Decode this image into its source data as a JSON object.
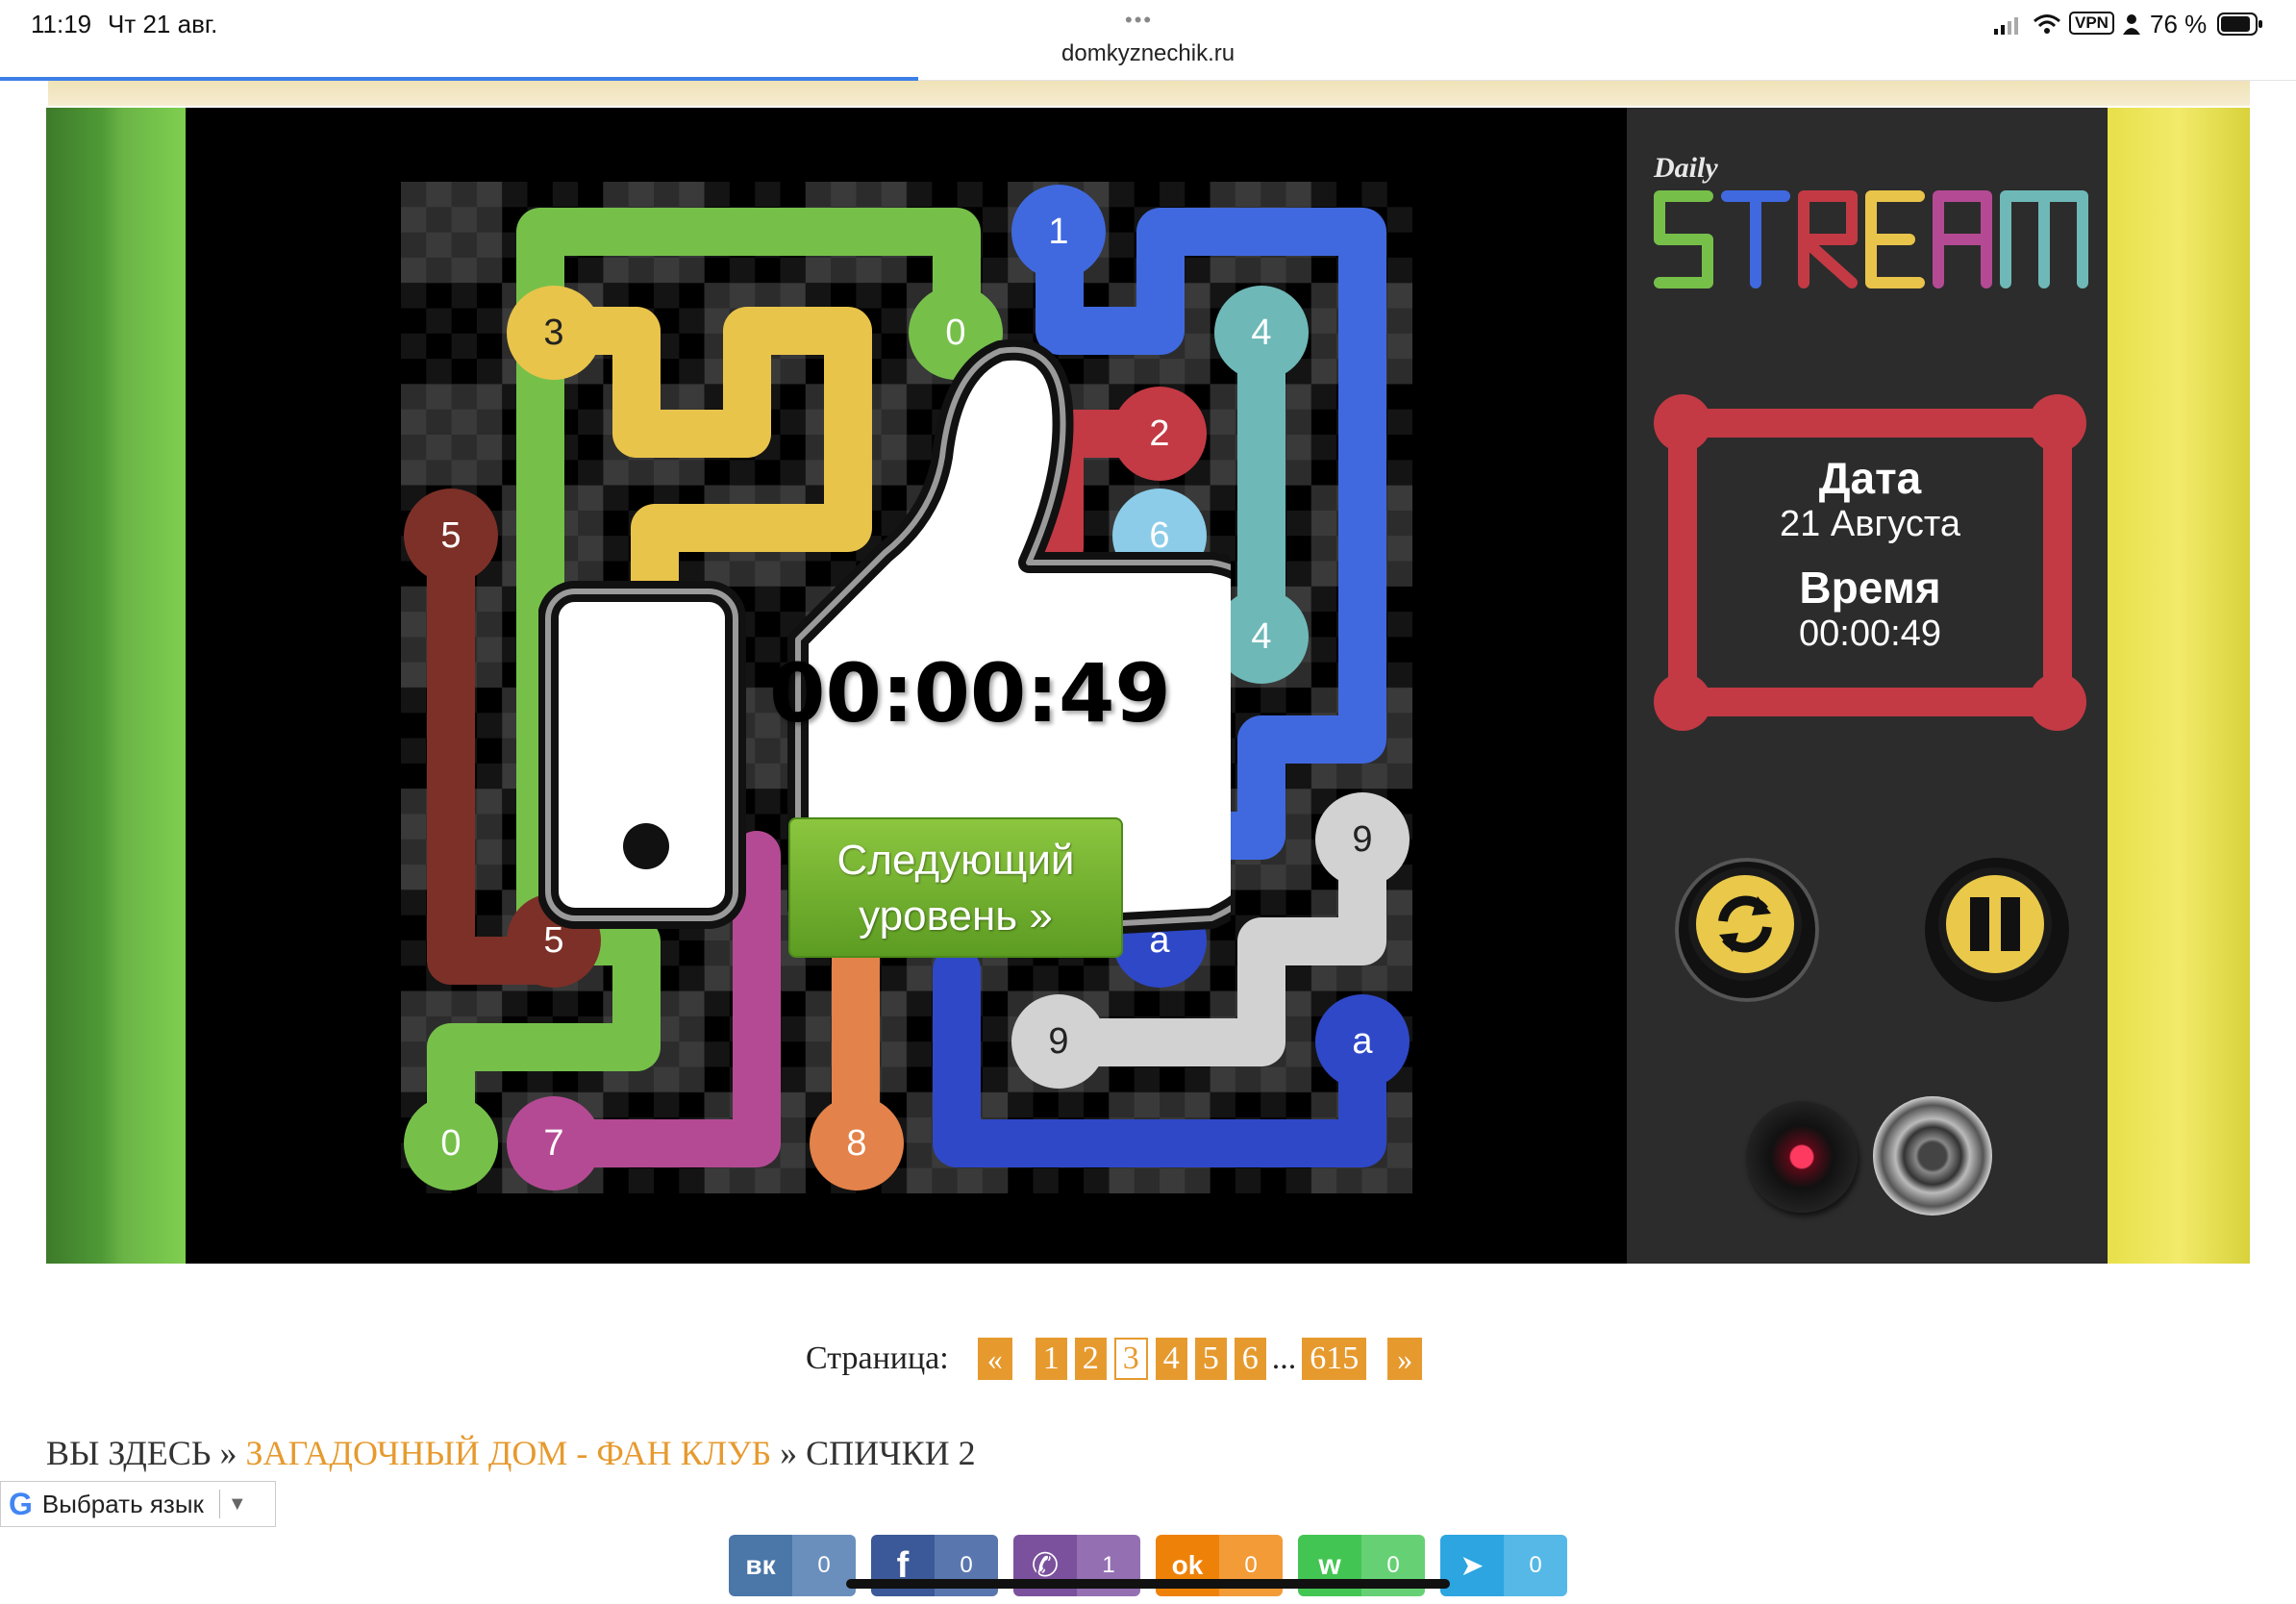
{
  "status_bar": {
    "time": "11:19",
    "date": "Чт 21 авг.",
    "vpn": "VPN",
    "battery": "76 %",
    "url": "domkyznechik.ru",
    "menu_dots": "•••"
  },
  "game": {
    "logo_small": "Daily",
    "logo_big": "STREAM",
    "info": {
      "date_label": "Дата",
      "date_value": "21 Августа",
      "time_label": "Время",
      "time_value": "00:00:49"
    },
    "overlay": {
      "time": "00:00:49",
      "next_button": "Следующий уровень »"
    },
    "dots": [
      {
        "label": "1"
      },
      {
        "label": "0"
      },
      {
        "label": "3"
      },
      {
        "label": "4"
      },
      {
        "label": "2"
      },
      {
        "label": "5"
      },
      {
        "label": "6"
      },
      {
        "label": "4"
      },
      {
        "label": "5"
      },
      {
        "label": "9"
      },
      {
        "label": "a"
      },
      {
        "label": "9"
      },
      {
        "label": "a"
      },
      {
        "label": "0"
      },
      {
        "label": "7"
      },
      {
        "label": "8"
      }
    ],
    "colors": {
      "green": "#76c04a",
      "yellow": "#e9c44a",
      "blue": "#4069e0",
      "teal": "#6fb8b8",
      "red": "#c33a44",
      "brown": "#7c3028",
      "pink": "#b54a94",
      "orange": "#e3824a",
      "gray": "#d2d2d2",
      "navy": "#2f48c8",
      "lightblue": "#8ccce8"
    }
  },
  "pagination": {
    "label": "Страница:",
    "prev": "«",
    "pages": [
      "1",
      "2",
      "3",
      "4",
      "5",
      "6"
    ],
    "current": "3",
    "ellipsis": "...",
    "last": "615",
    "next": "»"
  },
  "breadcrumb": {
    "here": "ВЫ ЗДЕСЬ",
    "sep1": "»",
    "link": "ЗАГАДОЧНЫЙ ДОМ - ФАН КЛУБ",
    "sep2": "»",
    "current": "СПИЧКИ 2"
  },
  "translate": {
    "label": "Выбрать язык",
    "arrow": "▼"
  },
  "share": [
    {
      "icon": "vk-icon",
      "short": "вк",
      "count": "0",
      "color": "#4a76a8"
    },
    {
      "icon": "facebook-icon",
      "short": "f",
      "count": "0",
      "color": "#3b5998"
    },
    {
      "icon": "viber-icon",
      "short": "✆",
      "count": "1",
      "color": "#7b519d"
    },
    {
      "icon": "odnoklassniki-icon",
      "short": "ok",
      "count": "0",
      "color": "#ee8208"
    },
    {
      "icon": "whatsapp-icon",
      "short": "w",
      "count": "0",
      "color": "#43c553"
    },
    {
      "icon": "telegram-icon",
      "short": "➤",
      "count": "0",
      "color": "#2ca5e0"
    }
  ]
}
